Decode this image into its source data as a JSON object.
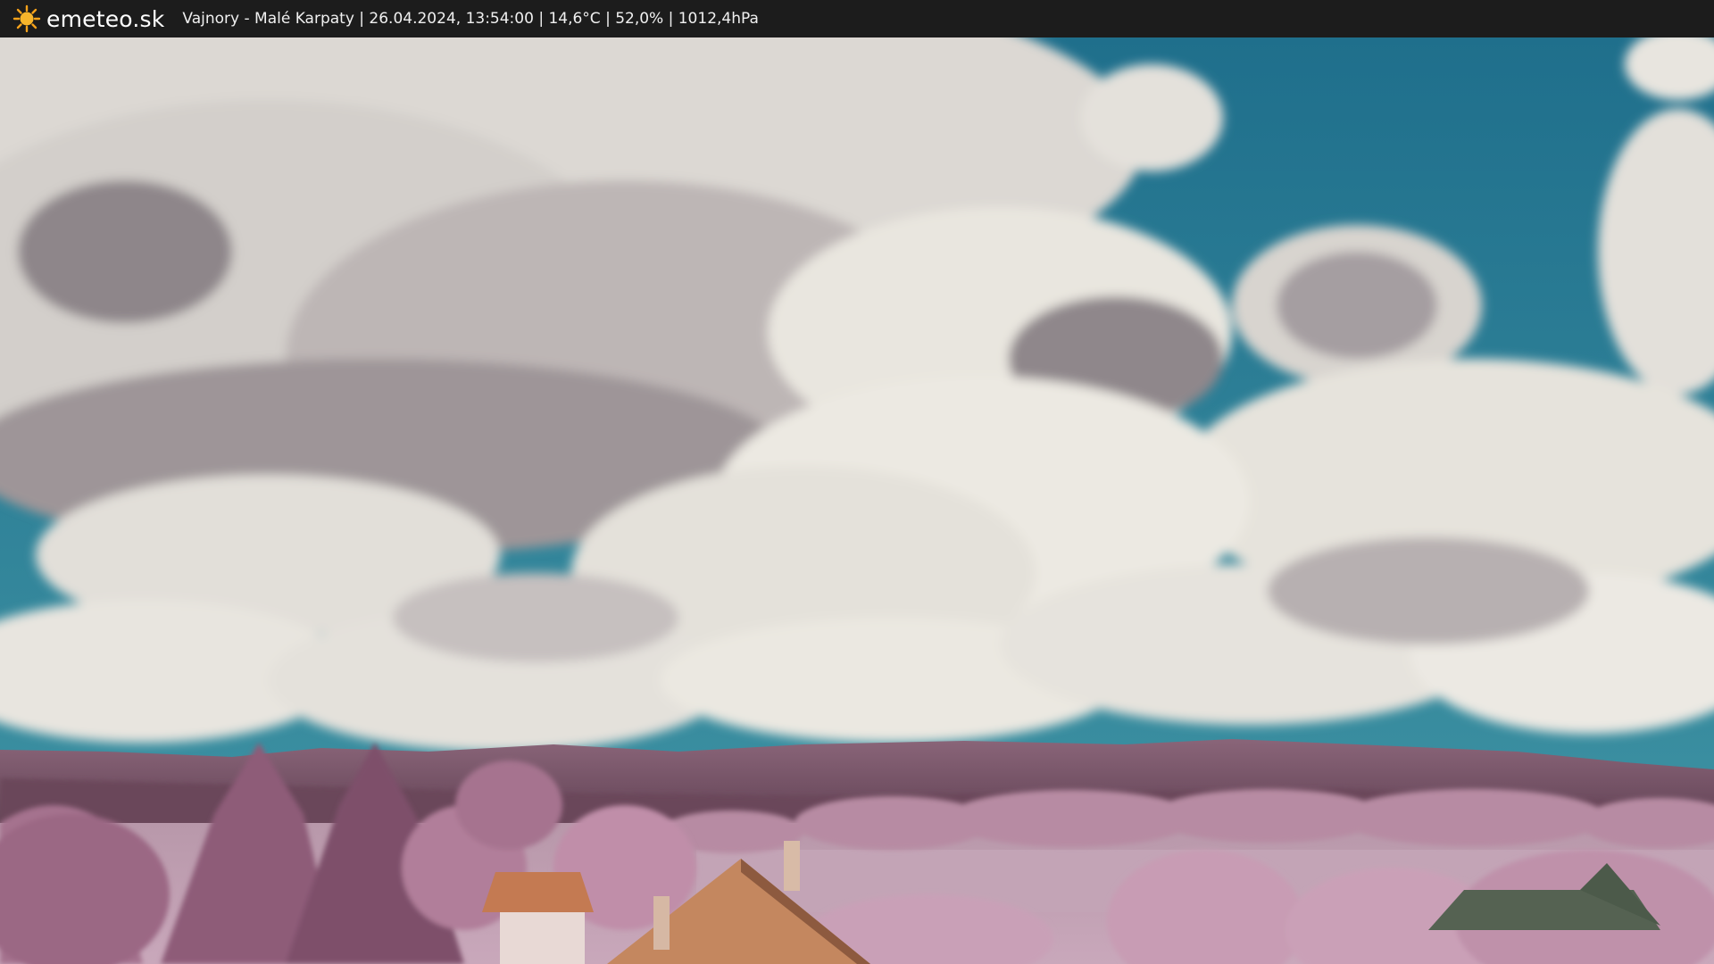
{
  "header": {
    "brand": "emeteo.sk",
    "logo_icon": "sun-icon",
    "info_line": "Vajnory - Malé Karpaty | 26.04.2024, 13:54:00 | 14,6°C | 52,0% | 1012,4hPa"
  },
  "colors": {
    "header_bg": "#1c1c1c",
    "sky": "#2b7a92",
    "cloud": "#e6e3dc",
    "cloud_shadow": "#8c8589",
    "hills": "#6e4a5e",
    "vegetation": "#c698b0",
    "roof": "#c07a55"
  }
}
